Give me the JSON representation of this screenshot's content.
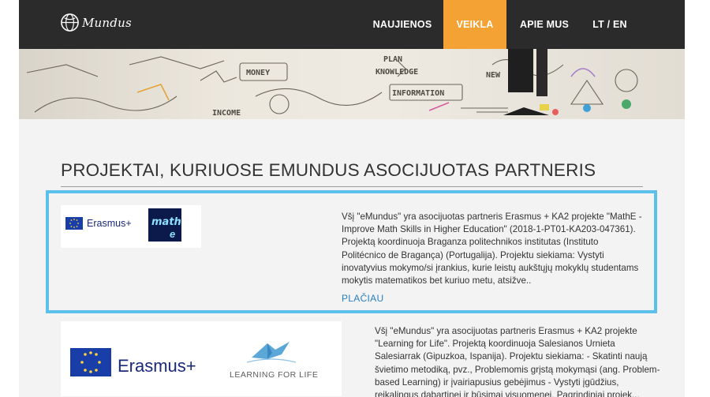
{
  "header": {
    "logo_text": "Mundus",
    "nav": [
      {
        "label": "NAUJIENOS"
      },
      {
        "label": "VEIKLA",
        "active": true
      },
      {
        "label": "APIE MUS"
      },
      {
        "label": "LT / EN"
      }
    ]
  },
  "banner": {
    "words": [
      "MONEY",
      "PLAN",
      "KNOWLEDGE",
      "INFORMATION",
      "NEW",
      "INCOME"
    ]
  },
  "page": {
    "title": "PROJEKTAI, KURIUOSE EMUNDUS ASOCIJUOTAS PARTNERIS"
  },
  "projects": [
    {
      "logo_brand": "Erasmus+",
      "logo_partner": "math",
      "text": "Všį \"eMundus\" yra asocijuotas partneris Erasmus + KA2 projekte \"MathE - Improve Math Skills in Higher Education\" (2018-1-PT01-KA203-047361). Projektą koordinuoja Braganza politechnikos institutas (Instituto Politécnico de Bragança) (Portugalija). Projektu siekiama: Vystyti inovatyvius mokymo/si įrankius, kurie leistų aukštųjų mokyklų studentams mokytis matematikos bet kuriuo metu, atsižve..",
      "more_label": "PLAČIAU"
    },
    {
      "logo_brand": "Erasmus+",
      "logo_partner": "LEARNING FOR LIFE",
      "text": "Všį \"eMundus\" yra asocijuotas partneris Erasmus + KA2 projekte \"Learning for Life\". Projektą koordinuoja Salesianos Urnieta Salesiarrak (Gipuzkoa, Ispanija). Projektu siekiama: - Skatinti naują švietimo metodiką, pvz., Problemomis grįstą mokymąsi (ang. Problem-based Learning) ir įvairiapusius gebėjimus - Vystyti įgūdžius, reikalingus dabartinei ir būsimai visuomenei. Pagrindiniai projek..."
    }
  ],
  "colors": {
    "header_bg": "#2b2b2b",
    "accent": "#f4a233",
    "highlight_border": "#5bc0ea",
    "link": "#2a7fbf",
    "erasmus_blue": "#1a3ea8"
  }
}
